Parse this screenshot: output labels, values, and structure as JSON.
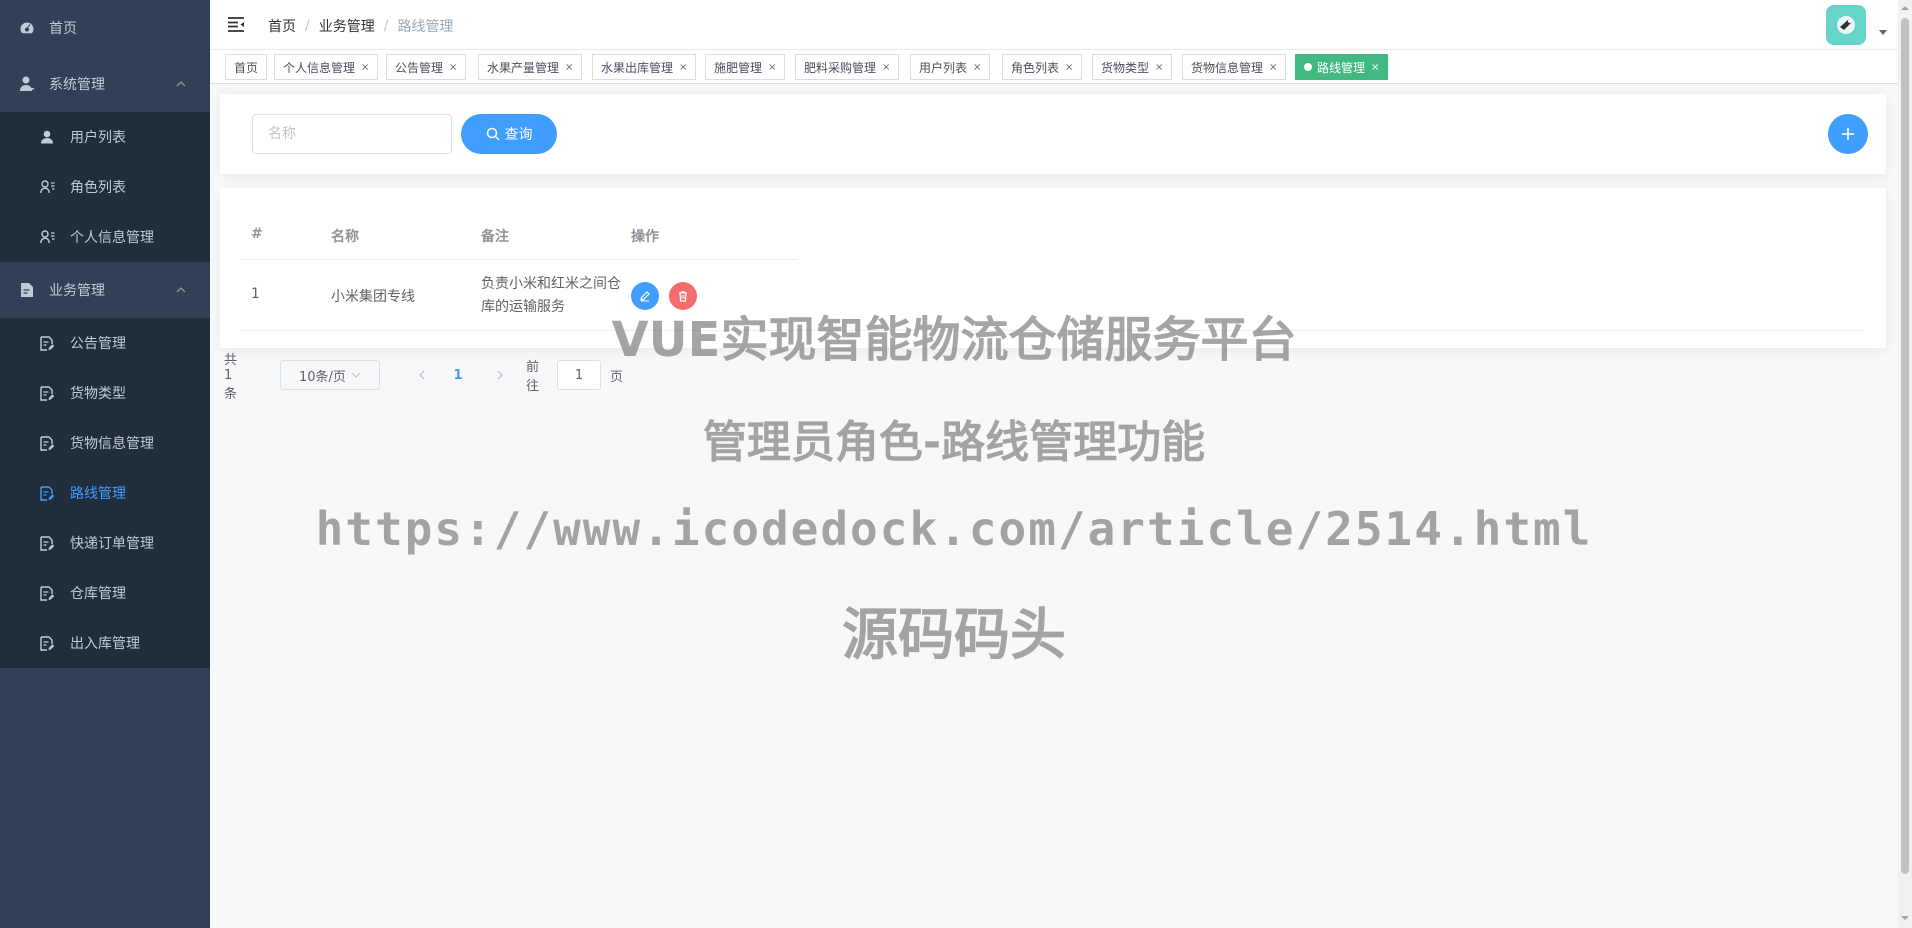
{
  "sidebar": {
    "home": "首页",
    "system": "系统管理",
    "system_items": [
      "用户列表",
      "角色列表",
      "个人信息管理"
    ],
    "business": "业务管理",
    "business_items": [
      "公告管理",
      "货物类型",
      "货物信息管理",
      "路线管理",
      "快递订单管理",
      "仓库管理",
      "出入库管理"
    ],
    "active_item": "路线管理",
    "active_color": "#409eff",
    "background": "#304156"
  },
  "breadcrumb": [
    "首页",
    "业务管理",
    "路线管理"
  ],
  "tags": [
    {
      "label": "首页",
      "closable": false
    },
    {
      "label": "个人信息管理",
      "closable": true
    },
    {
      "label": "公告管理",
      "closable": true
    },
    {
      "label": "水果产量管理",
      "closable": true
    },
    {
      "label": "水果出库管理",
      "closable": true
    },
    {
      "label": "施肥管理",
      "closable": true
    },
    {
      "label": "肥料采购管理",
      "closable": true
    },
    {
      "label": "用户列表",
      "closable": true
    },
    {
      "label": "角色列表",
      "closable": true
    },
    {
      "label": "货物类型",
      "closable": true
    },
    {
      "label": "货物信息管理",
      "closable": true
    },
    {
      "label": "路线管理",
      "closable": true,
      "active": true
    }
  ],
  "tag_close_glyph": "×",
  "search": {
    "placeholder": "名称",
    "query_label": "查询"
  },
  "table": {
    "headers": [
      "#",
      "名称",
      "备注",
      "操作"
    ],
    "rows": [
      {
        "index": "1",
        "name": "小米集团专线",
        "remark": "负责小米和红米之间仓库的运输服务"
      }
    ]
  },
  "pagination": {
    "total": "共 1 条",
    "page_size": "10条/页",
    "current_page": "1",
    "goto_label": "前往",
    "goto_value": "1",
    "page_suffix": "页"
  },
  "watermark": {
    "line1": "VUE实现智能物流仓储服务平台",
    "line2": "管理员角色-路线管理功能",
    "line3": "https://www.icodedock.com/article/2514.html",
    "line4": "源码码头"
  },
  "icons": {
    "home": "dashboard-icon",
    "system": "user-icon",
    "business": "document-icon",
    "hamburger": "menu-fold-icon",
    "search": "search-icon",
    "add": "plus-icon",
    "edit": "edit-icon",
    "delete": "delete-icon"
  }
}
